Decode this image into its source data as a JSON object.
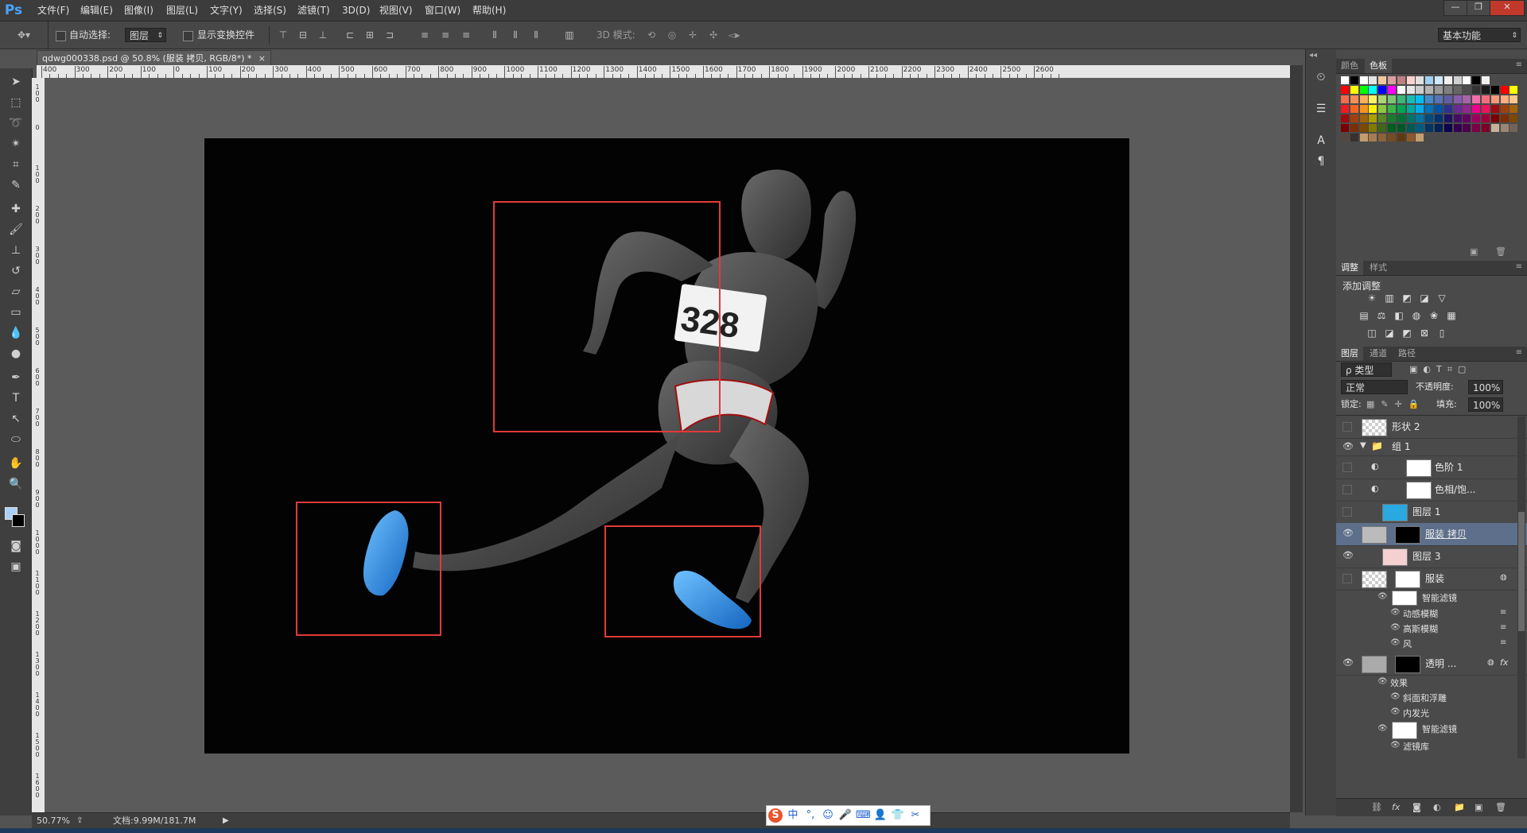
{
  "app": {
    "logo": "Ps"
  },
  "menu": [
    "文件(F)",
    "编辑(E)",
    "图像(I)",
    "图层(L)",
    "文字(Y)",
    "选择(S)",
    "滤镜(T)",
    "3D(D)",
    "视图(V)",
    "窗口(W)",
    "帮助(H)"
  ],
  "window_controls": {
    "minimize": "—",
    "restore": "❐",
    "close": "✕"
  },
  "options": {
    "auto_select_label": "自动选择:",
    "auto_select_value": "图层",
    "show_transform_label": "显示变换控件",
    "mode_3d_label": "3D 模式:",
    "workspace": "基本功能"
  },
  "document": {
    "tab_title": "qdwg000338.psd @ 50.8% (服装 拷贝, RGB/8*) *",
    "close": "×"
  },
  "ruler": {
    "top_labels": [
      "400",
      "300",
      "200",
      "100",
      "0",
      "100",
      "200",
      "300",
      "400",
      "500",
      "600",
      "700",
      "800",
      "900",
      "1000",
      "1100",
      "1200",
      "1300",
      "1400",
      "1500",
      "1600",
      "1700",
      "1800",
      "1900",
      "2000",
      "2100",
      "2200",
      "2300",
      "2400",
      "2500",
      "2600"
    ],
    "left_labels": [
      "1 0 0",
      "0",
      "1 0 0",
      "2 0 0",
      "3 0 0",
      "4 0 0",
      "5 0 0",
      "6 0 0",
      "7 0 0",
      "8 0 0",
      "9 0 0",
      "1 0 0 0",
      "1 1 0 0",
      "1 2 0 0",
      "1 3 0 0",
      "1 4 0 0",
      "1 5 0 0",
      "1 6 0 0"
    ]
  },
  "canvas": {
    "bib_number": "328"
  },
  "status": {
    "zoom": "50.77%",
    "doc_info": "文档:9.99M/181.7M"
  },
  "swatches_panel": {
    "tabs": [
      "颜色",
      "色板"
    ],
    "colors": {
      "row1": [
        "#ffffff",
        "#000000",
        "#ffffff",
        "#e3e3e3",
        "#f0c8a0",
        "#d8a0a0",
        "#c08080",
        "#ffd0d0",
        "#e0e0e0",
        "#a0d0f0",
        "#d0e8f8",
        "#f0f0f0",
        "#d0d0d0",
        "#ffffff",
        "#000000",
        "#f0f0f0"
      ],
      "row2": [
        "#ff0000",
        "#ffff00",
        "#00ff00",
        "#00ffff",
        "#0000ff",
        "#ff00ff",
        "#ffffff",
        "#e6e6e6",
        "#cccccc",
        "#b3b3b3",
        "#999999",
        "#808080",
        "#666666",
        "#4d4d4d",
        "#333333",
        "#1a1a1a",
        "#000000",
        "#ff0000",
        "#ffff00"
      ],
      "row3": [
        "#f26c4f",
        "#f68e55",
        "#fbaf5c",
        "#fff467",
        "#acd372",
        "#7cc576",
        "#3bb878",
        "#1abbb4",
        "#00bff3",
        "#438ccb",
        "#5574b9",
        "#605ca8",
        "#855fa8",
        "#a763a8",
        "#f06ea9",
        "#f26d7d",
        "#f7977a",
        "#f9ad81",
        "#fdc68a"
      ],
      "row4": [
        "#ed1c24",
        "#f26522",
        "#f7941d",
        "#fff200",
        "#8dc73f",
        "#39b54a",
        "#00a651",
        "#00a99d",
        "#00aeef",
        "#0072bc",
        "#0054a6",
        "#2e3192",
        "#662d91",
        "#92278f",
        "#ec008c",
        "#ed145b",
        "#9e0b0f",
        "#a0410d",
        "#a3620a"
      ],
      "row5": [
        "#9e0b0f",
        "#a0410d",
        "#a3620a",
        "#aba000",
        "#598527",
        "#1a7b30",
        "#007236",
        "#00746b",
        "#0076a3",
        "#004b80",
        "#003471",
        "#1b1464",
        "#440e62",
        "#630460",
        "#9e005d",
        "#9e0039",
        "#790000",
        "#7b2e00",
        "#7d4900"
      ],
      "row6": [
        "#790000",
        "#7b2e00",
        "#7d4900",
        "#827b00",
        "#406618",
        "#005e20",
        "#005826",
        "#005952",
        "#005b7f",
        "#003663",
        "#002157",
        "#0d004c",
        "#32004b",
        "#4b0049",
        "#7b0046",
        "#7a0026",
        "#c7b299",
        "#998675",
        "#736357"
      ],
      "row7": [
        "#534741",
        "#37302d",
        "#c69c6d",
        "#a67c52",
        "#8c6239",
        "#754c24",
        "#603913",
        "#8b5a2b",
        "#c2a070"
      ]
    }
  },
  "adjustments_panel": {
    "tabs": [
      "调整",
      "样式"
    ],
    "title": "添加调整",
    "icons_row1": [
      "☀",
      "▥",
      "◩",
      "◪",
      "▽"
    ],
    "icons_row2": [
      "▤",
      "⚖",
      "◧",
      "◍",
      "❀",
      "▦"
    ],
    "icons_row3": [
      "◫",
      "◪",
      "◩",
      "⊠",
      "▯"
    ]
  },
  "layers_panel": {
    "tabs": [
      "图层",
      "通道",
      "路径"
    ],
    "filter_kind": "ρ 类型",
    "blend_mode": "正常",
    "opacity_label": "不透明度:",
    "opacity_value": "100%",
    "lock_label": "锁定:",
    "fill_label": "填充:",
    "fill_value": "100%",
    "layers": [
      {
        "name": "形状 2"
      },
      {
        "name": "组 1"
      },
      {
        "name": "色阶 1"
      },
      {
        "name": "色相/饱..."
      },
      {
        "name": "图层 1"
      },
      {
        "name": "服装 拷贝"
      },
      {
        "name": "图层 3"
      },
      {
        "name": "服装"
      },
      {
        "name": "智能滤镜"
      },
      {
        "name": "动感模糊"
      },
      {
        "name": "高斯模糊"
      },
      {
        "name": "风"
      },
      {
        "name": "透明 ..."
      },
      {
        "name": "效果"
      },
      {
        "name": "斜面和浮雕"
      },
      {
        "name": "内发光"
      },
      {
        "name": "智能滤镜"
      },
      {
        "name": "滤镜库"
      }
    ]
  },
  "ime": {
    "logo": "S",
    "items": [
      "中",
      "°,",
      "☺",
      "🎤",
      "⌨",
      "👤",
      "👕",
      "✂"
    ]
  }
}
